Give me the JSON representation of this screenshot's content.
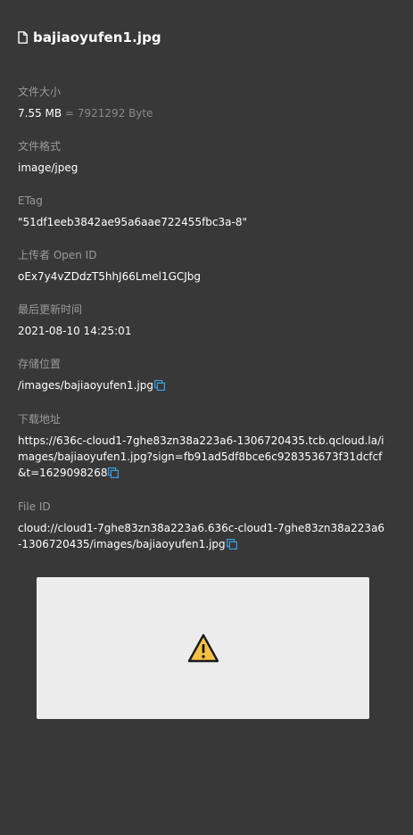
{
  "file": {
    "name": "bajiaoyufen1.jpg"
  },
  "fields": {
    "size": {
      "label": "文件大小",
      "value": "7.55 MB",
      "detail": "= 7921292 Byte"
    },
    "format": {
      "label": "文件格式",
      "value": "image/jpeg"
    },
    "etag": {
      "label": "ETag",
      "value": "\"51df1eeb3842ae95a6aae722455fbc3a-8\""
    },
    "uploader": {
      "label": "上传者 Open ID",
      "value": "oEx7y4vZDdzT5hhJ66Lmel1GCJbg"
    },
    "updated": {
      "label": "最后更新时间",
      "value": "2021-08-10 14:25:01"
    },
    "location": {
      "label": "存储位置",
      "value": "/images/bajiaoyufen1.jpg"
    },
    "download": {
      "label": "下载地址",
      "value": "https://636c-cloud1-7ghe83zn38a223a6-1306720435.tcb.qcloud.la/images/bajiaoyufen1.jpg?sign=fb91ad5df8bce6c928353673f31dcfcf&t=1629098268"
    },
    "fileid": {
      "label": "File ID",
      "value": "cloud://cloud1-7ghe83zn38a223a6.636c-cloud1-7ghe83zn38a223a6-1306720435/images/bajiaoyufen1.jpg"
    }
  },
  "icons": {
    "file": "file-icon",
    "copy": "copy-icon",
    "preview_error": "warning-icon"
  },
  "colors": {
    "background": "#383838",
    "label": "#9a9a9a",
    "value": "#ffffff",
    "copy_icon": "#3b9fe0",
    "warning_fill": "#f6c142",
    "preview_bg": "#ececec"
  }
}
